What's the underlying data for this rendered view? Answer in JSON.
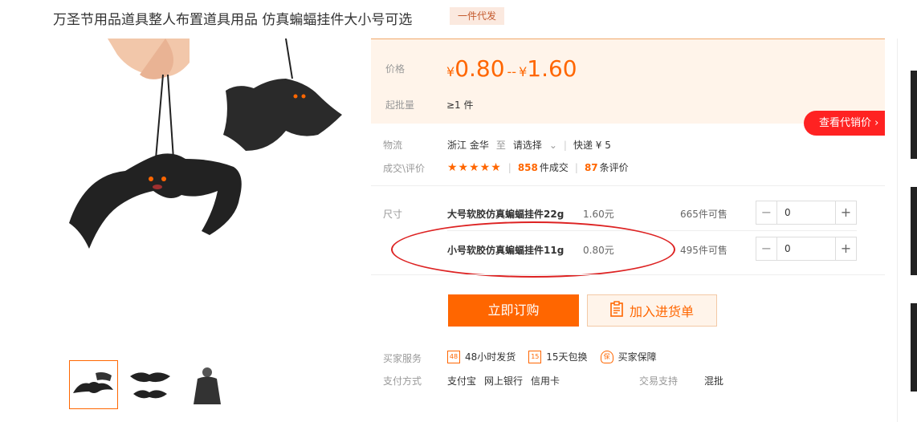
{
  "product": {
    "title": "万圣节用品道具整人布置道具用品 仿真蝙蝠挂件大小号可选",
    "tag": "一件代发"
  },
  "price": {
    "label": "价格",
    "currency": "¥",
    "low": "0.80",
    "dash": "--",
    "high": "1.60",
    "batch_label": "起批量",
    "batch_value": "≥1 件"
  },
  "agent_button": "查看代销价",
  "logistics": {
    "label": "物流",
    "from": "浙江 金华",
    "to_word": "至",
    "select": "请选择",
    "express": "快递 ¥ 5"
  },
  "deals": {
    "label": "成交\\评价",
    "stars": "★★★★★",
    "deal_count": "858",
    "deal_suffix": "件成交",
    "review_count": "87",
    "review_suffix": "条评价"
  },
  "sku": {
    "label": "尺寸",
    "items": [
      {
        "name": "大号软胶仿真蝙蝠挂件22g",
        "price": "1.60元",
        "stock": "665件可售",
        "qty": "0"
      },
      {
        "name": "小号软胶仿真蝙蝠挂件11g",
        "price": "0.80元",
        "stock": "495件可售",
        "qty": "0"
      }
    ]
  },
  "actions": {
    "buy": "立即订购",
    "cart": "加入进货单"
  },
  "services": {
    "label": "买家服务",
    "items": [
      "48小时发货",
      "15天包换",
      "买家保障"
    ],
    "icons": [
      "48",
      "15",
      "保"
    ]
  },
  "payment": {
    "label": "支付方式",
    "items": [
      "支付宝",
      "网上银行",
      "信用卡"
    ]
  },
  "trade": {
    "label": "交易支持",
    "value": "混批"
  },
  "colors": {
    "accent": "#ff6600",
    "red": "#ff2222",
    "panel_bg": "#fff4ea"
  }
}
